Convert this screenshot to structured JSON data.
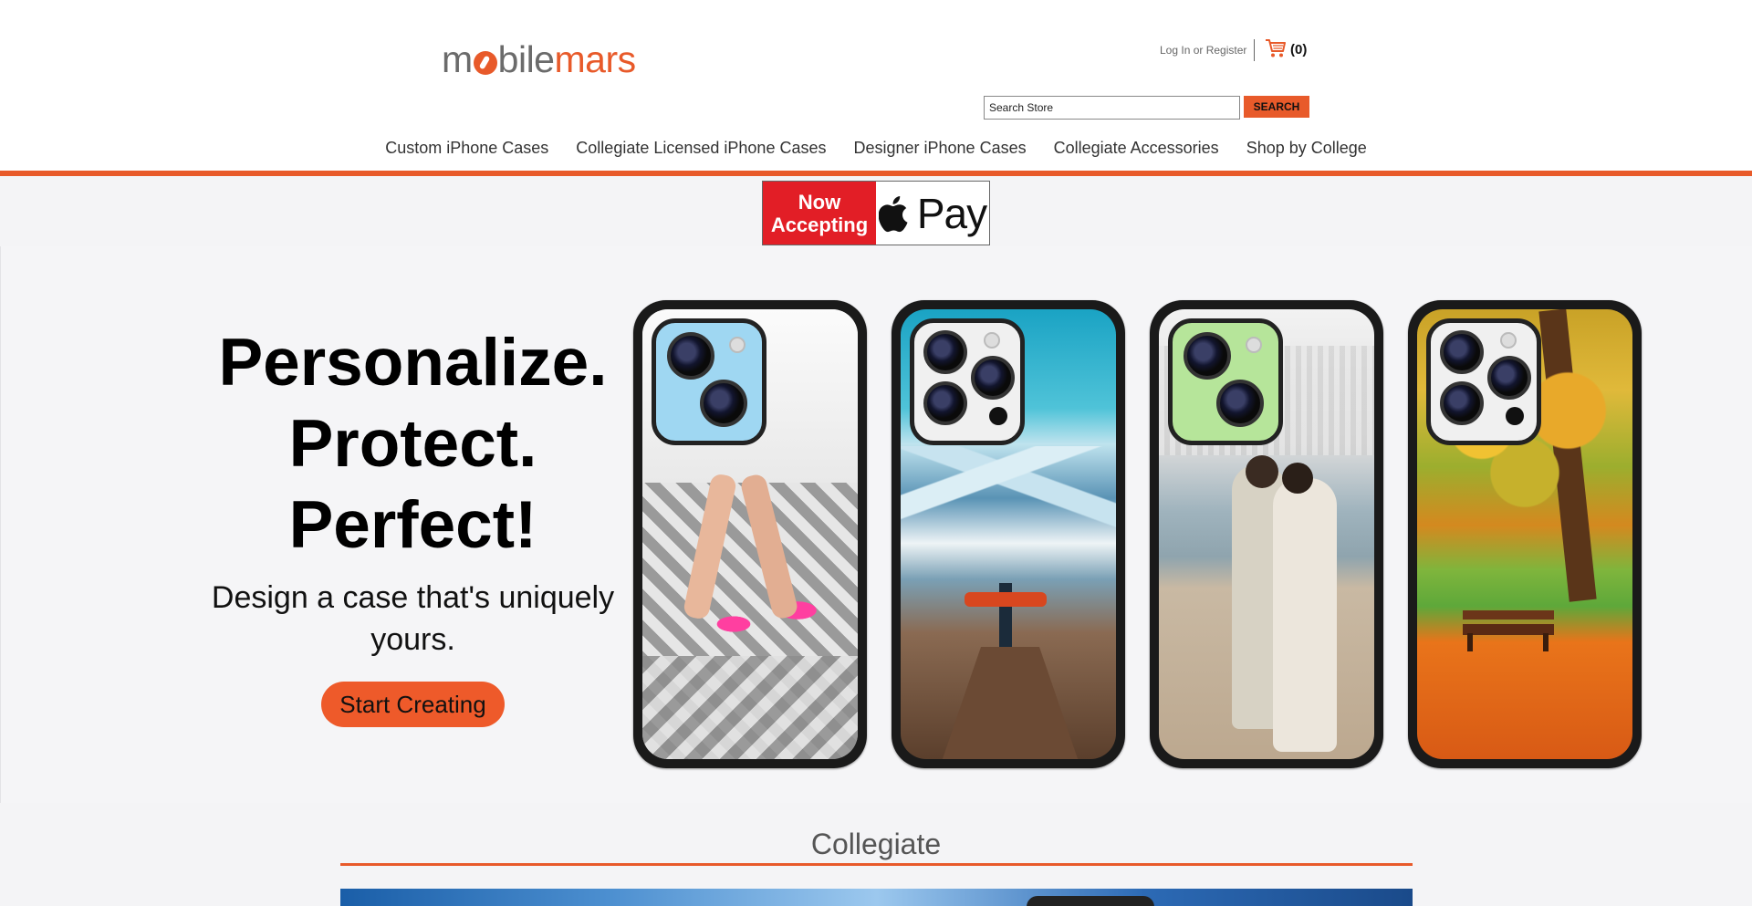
{
  "header": {
    "logo_part1": "m",
    "logo_part2": "bile",
    "logo_part3": "mars",
    "login_label": "Log In or Register",
    "cart_count": "(0)",
    "search": {
      "value": "Search Store",
      "button_label": "SEARCH"
    }
  },
  "nav": {
    "items": [
      "Custom iPhone Cases",
      "Collegiate Licensed iPhone Cases",
      "Designer iPhone Cases",
      "Collegiate Accessories",
      "Shop by College"
    ]
  },
  "banner": {
    "line1": "Now",
    "line2": "Accepting",
    "pay_label": "Pay"
  },
  "hero": {
    "line1": "Personalize.",
    "line2": "Protect.",
    "line3": "Perfect!",
    "subtitle": "Design a case that's uniquely yours.",
    "cta_label": "Start Creating"
  },
  "section": {
    "title": "Collegiate"
  },
  "colors": {
    "accent": "#e85a2a",
    "apple_pay_red": "#e21e26"
  }
}
